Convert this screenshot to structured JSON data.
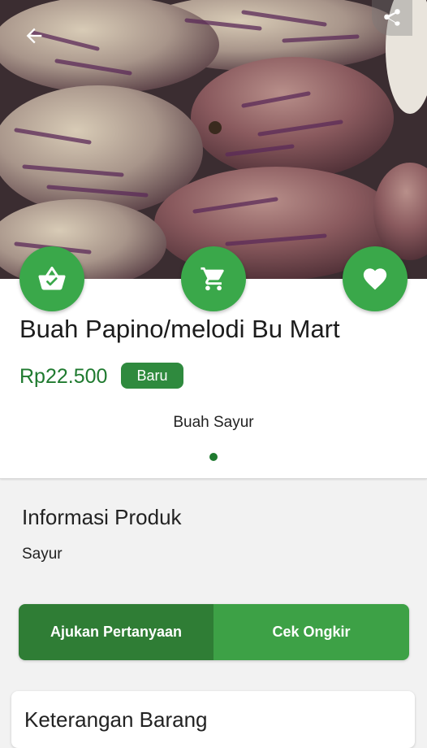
{
  "product": {
    "title": "Buah Papino/melodi Bu Mart",
    "price": "Rp22.500",
    "condition_badge": "Baru",
    "category": "Buah Sayur"
  },
  "info": {
    "heading": "Informasi Produk",
    "value": "Sayur"
  },
  "actions": {
    "ask_label": "Ajukan Pertanyaan",
    "shipping_label": "Cek Ongkir"
  },
  "description": {
    "heading": "Keterangan Barang"
  },
  "icons": {
    "back": "arrow-left-icon",
    "share": "share-icon",
    "basket": "basket-check-icon",
    "cart": "cart-icon",
    "wishlist": "heart-icon"
  },
  "colors": {
    "accent_green": "#3aa84a",
    "dark_green": "#2f7d35",
    "price_green": "#1f7a2f"
  },
  "carousel": {
    "total_slides": 1,
    "active_slide": 1
  }
}
